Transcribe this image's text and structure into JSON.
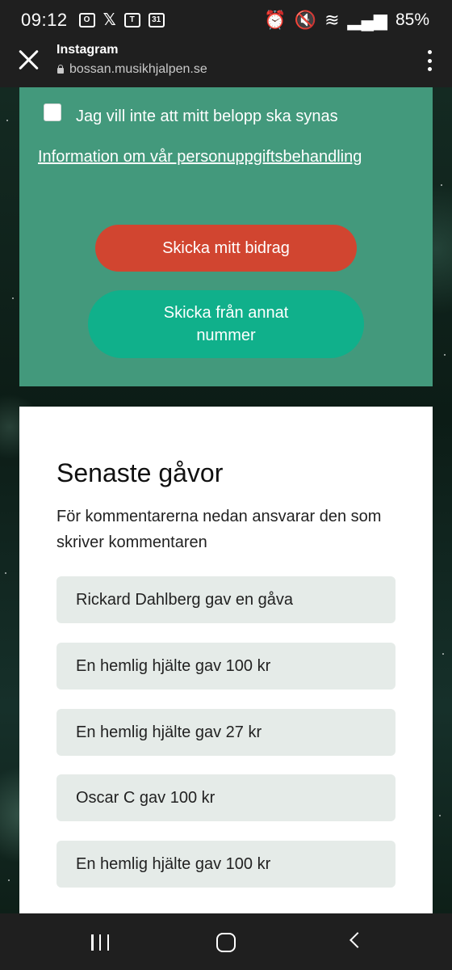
{
  "status_bar": {
    "time": "09:12",
    "notification_icons": [
      "outlook-icon",
      "x-icon",
      "teams-icon",
      "calendar-icon"
    ],
    "calendar_day": "31",
    "battery": "85%"
  },
  "browser": {
    "title": "Instagram",
    "url": "bossan.musikhjalpen.se"
  },
  "form": {
    "hide_amount_label": "Jag vill inte att mitt belopp ska synas",
    "hide_amount_checked": false,
    "privacy_link": "Information om vår personuppgiftsbehandling",
    "submit_button": "Skicka mitt bidrag",
    "other_number_button": "Skicka från annat nummer"
  },
  "gifts": {
    "title": "Senaste gåvor",
    "description": "För kommentarerna nedan ansvarar den som skriver kommentaren",
    "items": [
      "Rickard Dahlberg gav en gåva",
      "En hemlig hjälte gav 100 kr",
      "En hemlig hjälte gav 27 kr",
      "Oscar C gav 100 kr",
      "En hemlig hjälte gav 100 kr"
    ]
  },
  "colors": {
    "form_panel": "#43997c",
    "submit_button": "#d14530",
    "other_number_button": "#10b08b",
    "gift_item_bg": "#e5ebe8"
  }
}
